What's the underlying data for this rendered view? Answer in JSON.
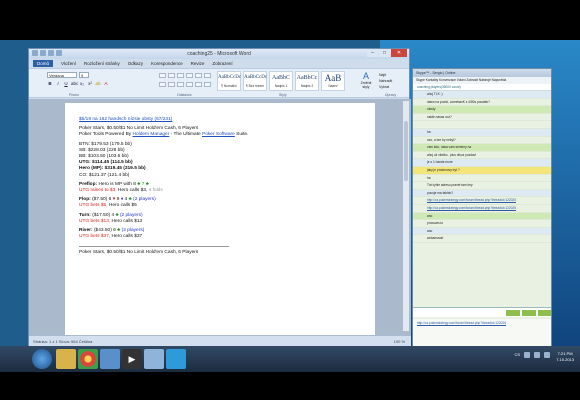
{
  "word": {
    "title": "coaching25 - Microsoft Word",
    "tabs": [
      "Domů",
      "Vložení",
      "Rozložení stránky",
      "Odkazy",
      "Korespondence",
      "Revize",
      "Zobrazení"
    ],
    "font_name": "Verdana",
    "font_size": "9",
    "group_labels": {
      "font": "Písmo",
      "paragraph": "Odstavec",
      "styles": "Styly",
      "editing": "Úpravy"
    },
    "styles": [
      {
        "sample": "AaBbCcDc",
        "name": "¶ Normální"
      },
      {
        "sample": "AaBbCcDc",
        "name": "¶ Bez mezer"
      },
      {
        "sample": "AaBbC",
        "name": "Nadpis 1"
      },
      {
        "sample": "AaBbCc",
        "name": "Nadpis 2"
      },
      {
        "sample": "AaB",
        "name": "Název"
      }
    ],
    "change_styles": "Změnit styly",
    "editing": [
      "Najít",
      "Nahradit",
      "Vybrat"
    ],
    "statusbar": {
      "left": "Stránka: 1 z 1   Slova: 564   Čeština",
      "zoom": "100 %"
    }
  },
  "doc": {
    "link_line": "$5/19 na 162 handsch nízsie obsty (57/231)",
    "header_intro": "Poker Stars, $0.50/$1 No Limit Hold'em Cash, 6 Players",
    "header_tools_pre": "Poker Tools Powered By ",
    "header_tools_link": "Holdem Manager",
    "header_tools_mid": " - The Ultimate ",
    "header_tools_link2": "Poker Software",
    "header_tools_post": " Suite.",
    "stacks": [
      {
        "text": "BTN: $179.53 (179.5 bb)",
        "bold": false
      },
      {
        "text": "SB: $228.03 (228 bb)",
        "bold": false
      },
      {
        "text": "BB: $103.50 (103.5 bb)",
        "bold": false
      },
      {
        "text": "UTG: $114.45 (114.5 bb)",
        "bold": true
      },
      {
        "text": "Hero (MP): $319.45 (319.5 bb)",
        "bold": true
      },
      {
        "text": "CO: $121.37 (121.4 bb)",
        "bold": false
      }
    ],
    "preflop_label": "Preflop:",
    "preflop_text": " Hero is MP with 8 ",
    "preflop_cards": "♣ 7 ♣",
    "preflop_action": "UTG raises to $3, ",
    "preflop_action2": "Hero calls $3, ",
    "preflop_folds": "4 folds",
    "flop_label": "Flop:",
    "flop_pot": " ($7.50) 6 ",
    "flop_players": "(2 players)",
    "flop_action": "UTG bets $5, ",
    "flop_action2": "Hero calls $5",
    "turn_label": "Turn:",
    "turn_pot": " ($17.50) 4 ",
    "turn_players": "(2 players)",
    "turn_action": "UTG bets $13, ",
    "turn_action2": "Hero calls $13",
    "river_label": "River:",
    "river_pot": " ($43.50) 6 ",
    "river_players": "(2 players)",
    "river_action": "UTG bets $37, ",
    "river_action2": "Hero calls $37",
    "footer_intro": "Poker Stars, $0.50/$1 No Limit Hold'em Cash, 6 Players"
  },
  "skype": {
    "title": "Skype™ - Sergio | Online",
    "menu": "Skype  Kontakty  Konverzace  Volání  Zobrazit  Nástroje  Nápověda",
    "subheader": "coaching players(35000 count)",
    "messages": [
      {
        "text": "ahoj TLK :)",
        "style": "alt"
      },
      {
        "text": "dawn na pozici, comebacK s 4/80s pocatek?",
        "style": ""
      },
      {
        "text": "okedy",
        "style": "grn"
      },
      {
        "text": "catde nasas voz?",
        "style": ""
      },
      {
        "text": "",
        "style": ""
      },
      {
        "text": "ha",
        "style": "alt"
      },
      {
        "text": "ceo, a bre by nebyl?",
        "style": ""
      },
      {
        "text": "vam kdo, nasa vam semeny na",
        "style": "grn"
      },
      {
        "text": "ahoj už všetko.. plus nikoz pozdav!",
        "style": ""
      },
      {
        "text": "je o 1 hande more",
        "style": "alt"
      },
      {
        "text": "jaky je prostorovy byt ?",
        "style": "hl"
      },
      {
        "text": "ha",
        "style": ""
      },
      {
        "text": "Tuh tyhle adresu pravet tam bey",
        "style": ""
      },
      {
        "text": "pocuje ma takhto?",
        "style": "alt"
      },
      {
        "text": "http://cz.pokerstrategy.com/forum/thread.php?threadid=122025",
        "style": "link"
      },
      {
        "text": "http://cz.pokerstrategy.com/forum/thread.php?threadid=122025",
        "style": "link"
      },
      {
        "text": "ano",
        "style": "grn"
      },
      {
        "text": "procuam-tz",
        "style": ""
      },
      {
        "text": "ano",
        "style": "alt"
      },
      {
        "text": "wokamaost",
        "style": ""
      }
    ],
    "bottom_link": "http://cz.pokerstrategy.com/forum/thread.php?threadid=122025"
  },
  "taskbar": {
    "lang": "CS",
    "time": "7:21 PM",
    "date": "7.10.2013"
  }
}
